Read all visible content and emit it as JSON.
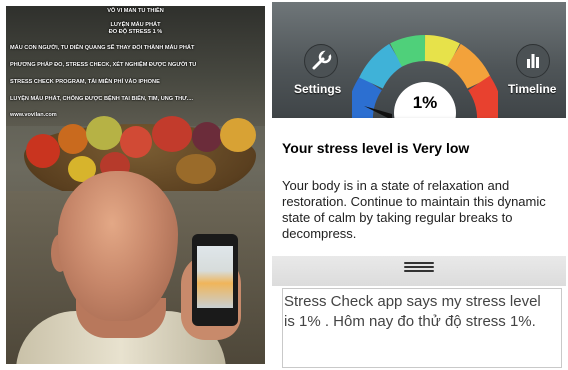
{
  "photo_overlay": {
    "title_lines": [
      "VÔ VI MAN TU THIỀN",
      "LUYỆN MÁU PHÁT",
      "ĐO ĐỘ STRESS 1 %"
    ],
    "body_lines": [
      "MÁU CON NGƯỜI, TU DIỄN QUANG SẼ THAY ĐỔI THÀNH MÁU PHÁT",
      "PHƯƠNG PHÁP ĐO, STRESS CHECK, XÉT NGHIỆM ĐƯỢC NGƯỜI TU",
      "STRESS CHECK PROGRAM, TẢI MIỄN PHÍ VÀO IPHONE",
      "LUYỆN MÁU PHÁT, CHỐNG ĐƯỢC BỆNH TAI BIẾN, TIM, UNG THƯ....",
      "www.vovilan.com"
    ]
  },
  "app": {
    "settings_label": "Settings",
    "timeline_label": "Timeline",
    "settings_icon": "wrench-icon",
    "timeline_icon": "bar-chart-icon",
    "stress_percent": 1,
    "stress_percent_text": "1%",
    "result_title": "Your stress level is Very low",
    "result_body": "Your body is in a state of relaxation and restoration. Continue to maintain this dynamic state of calm by taking regular breaks to decompress.",
    "drag_handle_icon": "drag-handle-icon"
  },
  "caption": {
    "text": "Stress Check app says my stress level is 1% . Hôm nay đo thử độ stress 1%."
  },
  "colors": {
    "gauge_colors": [
      "#2c6fd1",
      "#3fb2d8",
      "#4fd07a",
      "#e7e24a",
      "#f3a23b",
      "#e8412f"
    ]
  }
}
